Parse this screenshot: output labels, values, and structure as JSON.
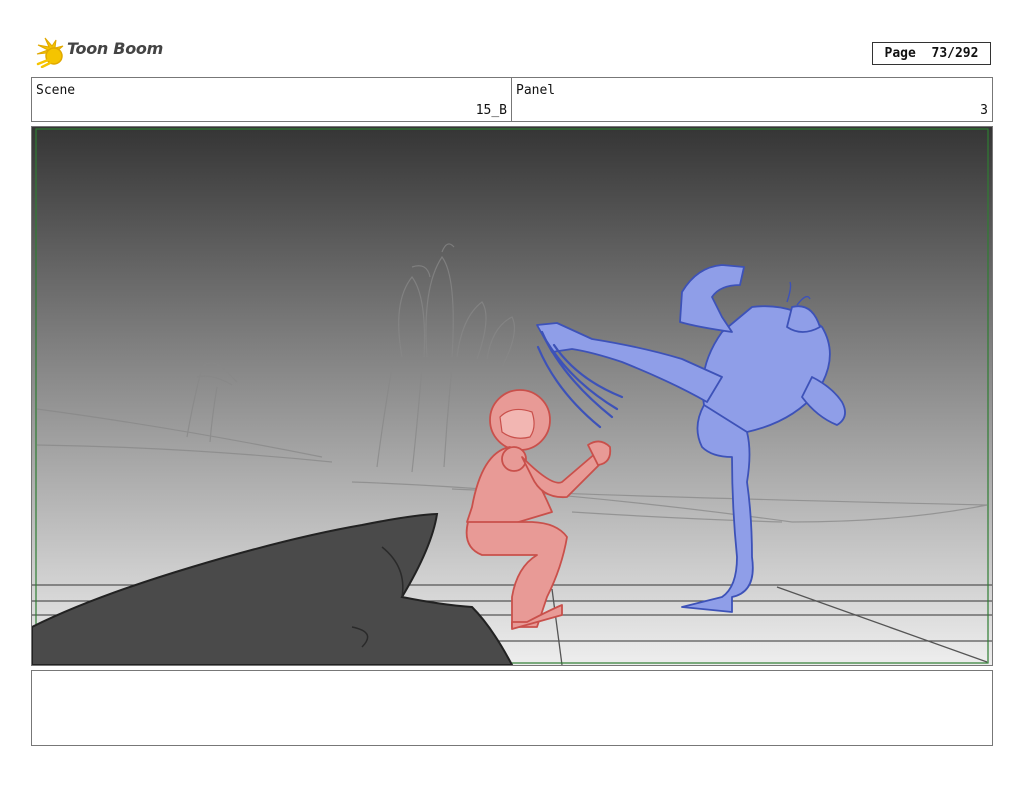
{
  "header": {
    "logo_text": "Toon Boom",
    "page_label": "Page",
    "page_value": "73/292"
  },
  "scene": {
    "label": "Scene",
    "value": "15_B"
  },
  "panel": {
    "label": "Panel",
    "value": "3"
  },
  "colors": {
    "sky_top": "#353535",
    "sky_bottom": "#eeeeee",
    "safe_frame": "#2e7d32",
    "crouching_figure": "#e89a96",
    "kicking_figure": "#8f9ee8",
    "rock": "#4a4a4a",
    "logo_accent": "#f5c400"
  },
  "notes": ""
}
